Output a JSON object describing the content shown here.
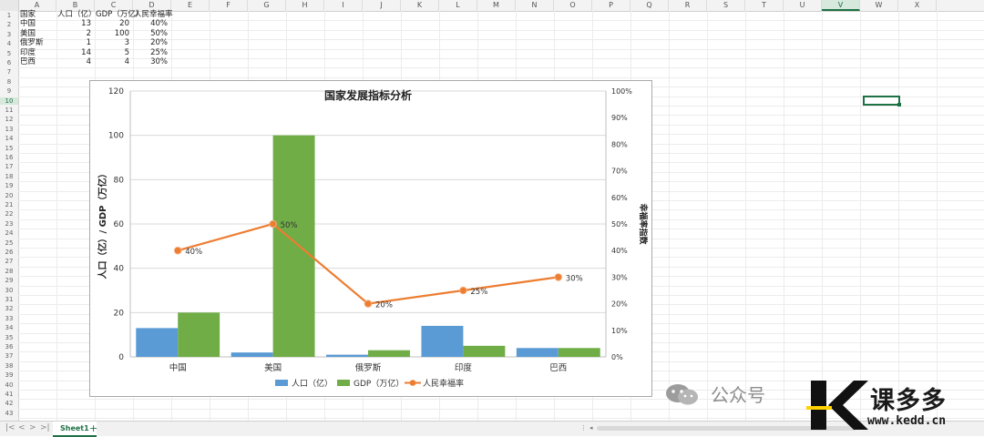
{
  "spreadsheet": {
    "columns": [
      "A",
      "B",
      "C",
      "D",
      "E",
      "F",
      "G",
      "H",
      "I",
      "J",
      "K",
      "L",
      "M",
      "N",
      "O",
      "P",
      "Q",
      "R",
      "S",
      "T",
      "U",
      "V",
      "W",
      "X"
    ],
    "selected_column": "V",
    "rows": [
      "1",
      "2",
      "3",
      "4",
      "5",
      "6",
      "7",
      "8",
      "9",
      "10",
      "11",
      "12",
      "13",
      "14",
      "15",
      "16",
      "17",
      "18",
      "19",
      "20",
      "21",
      "22",
      "23",
      "24",
      "25",
      "26",
      "27",
      "28",
      "29",
      "30",
      "31",
      "32",
      "33",
      "34",
      "35",
      "36",
      "37",
      "38",
      "39",
      "40",
      "41",
      "42",
      "43"
    ],
    "selected_row": "10",
    "cells": {
      "header": [
        "国家",
        "人口（亿）",
        "GDP（万亿）",
        "人民幸福率"
      ],
      "data": [
        [
          "中国",
          "13",
          "20",
          "40%"
        ],
        [
          "美国",
          "2",
          "100",
          "50%"
        ],
        [
          "俄罗斯",
          "1",
          "3",
          "20%"
        ],
        [
          "印度",
          "14",
          "5",
          "25%"
        ],
        [
          "巴西",
          "4",
          "4",
          "30%"
        ]
      ]
    }
  },
  "chart_data": {
    "type": "bar",
    "title": "国家发展指标分析",
    "categories": [
      "中国",
      "美国",
      "俄罗斯",
      "印度",
      "巴西"
    ],
    "series": [
      {
        "name": "人口（亿）",
        "type": "bar",
        "axis": "left",
        "color": "#5b9bd5",
        "values": [
          13,
          2,
          1,
          14,
          4
        ]
      },
      {
        "name": "GDP（万亿）",
        "type": "bar",
        "axis": "left",
        "color": "#70ad47",
        "values": [
          20,
          100,
          3,
          5,
          4
        ]
      },
      {
        "name": "人民幸福率",
        "type": "line",
        "axis": "right",
        "color": "#ed7d31",
        "values": [
          0.4,
          0.5,
          0.2,
          0.25,
          0.3
        ],
        "labels": [
          "40%",
          "50%",
          "20%",
          "25%",
          "30%"
        ]
      }
    ],
    "ylabel": "人口（亿）/ GDP（万亿）",
    "y2label": "幸福率指数",
    "ylim": [
      0,
      120
    ],
    "yticks": [
      "0",
      "20",
      "40",
      "60",
      "80",
      "100",
      "120"
    ],
    "y2lim": [
      0,
      1
    ],
    "y2ticks": [
      "0%",
      "10%",
      "20%",
      "30%",
      "40%",
      "50%",
      "60%",
      "70%",
      "80%",
      "90%",
      "100%"
    ],
    "grid": true,
    "legend_position": "bottom"
  },
  "statusbar": {
    "sheet_tab": "Sheet1",
    "add_sheet": "+",
    "nav_first": "|<",
    "nav_prev": "<",
    "nav_next": ">",
    "nav_last": ">|"
  },
  "watermark": {
    "text": "公众号",
    "brand": "课多多",
    "url": "www.kedd.cn"
  },
  "colors": {
    "accent": "#1e7145",
    "bar_blue": "#5b9bd5",
    "bar_green": "#70ad47",
    "line_orange": "#ed7d31"
  }
}
